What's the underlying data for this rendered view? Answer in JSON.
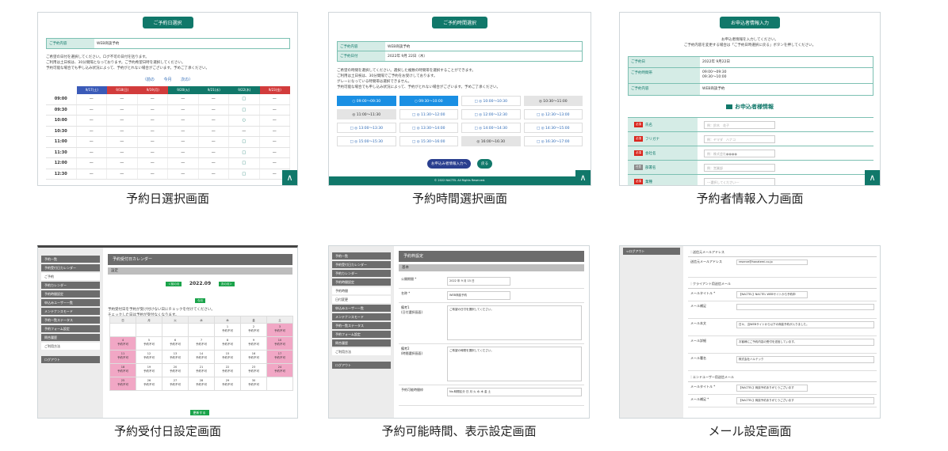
{
  "captions": [
    "予約日選択画面",
    "予約時間選択画面",
    "予約者情報入力画面",
    "予約受付日設定画面",
    "予約可能時間、表示設定画面",
    "メール設定画面"
  ],
  "s1": {
    "pill": "ご予約日選択",
    "row_key": "ご予約内容",
    "row_val": "WEB商談予約",
    "notes": [
      "ご希望の日付を選択してください。ログ不可の日付を括ります。",
      "ご利用は土日祝は、30分間隔となっております。ご予約希望日時を選択してください。",
      "予約可能な場合でも申し込み状況によって、予約がとれない場合がございます。予めご了承ください。"
    ],
    "nav": [
      "〈前の",
      "今月",
      "次の〉"
    ],
    "days": [
      "9/17(土)",
      "9/18(日)",
      "9/19(月)",
      "9/20(火)",
      "9/21(水)",
      "9/22(木)",
      "9/23(金)"
    ],
    "times": [
      "09:00",
      "09:30",
      "10:00",
      "10:30",
      "11:00",
      "11:30",
      "12:00",
      "12:30"
    ]
  },
  "s2": {
    "pill": "ご予約時間選択",
    "rows": [
      {
        "k": "ご予約内容",
        "v": "WEB商談予約"
      },
      {
        "k": "ご予約日付",
        "v": "2022年 9月 22日（木）"
      }
    ],
    "notes": [
      "ご希望の時間を選択してください。選択した複数の時間帯を選択することができます。",
      "ご利用は土日祝は、30分間隔でご予約をお受けしております。",
      "グレーになっている時間帯は選択できません。",
      "予約可能な場合でも申し込み状況によって、予約がとれない場合がございます。予めご了承ください。"
    ],
    "slots": [
      "○ 09:00〜09:30",
      "○ 09:30〜10:00",
      "□ ◎ 10:00〜10:30",
      "◎ 10:30〜11:00",
      "◎ 11:00〜11:30",
      "□ ◎ 11:30〜12:00",
      "□ ◎ 12:00〜12:30",
      "□ ◎ 12:30〜13:00",
      "□ ◎ 13:00〜13:30",
      "□ ◎ 13:30〜14:00",
      "□ ◎ 14:00〜14:30",
      "□ ◎ 14:30〜15:00",
      "□ ◎ 15:00〜15:30",
      "□ ◎ 15:30〜16:00",
      "◎ 16:00〜16:30",
      "□ ◎ 16:30〜17:00"
    ],
    "btn_main": "お申込み者情報入力へ",
    "btn_back": "戻る",
    "footer": "© 2022 NACTEL All Rights Reserved."
  },
  "s3": {
    "pill": "お申込者情報入力",
    "notes": [
      "お申込者情報を入力してください。",
      "ご予約内容を変更する場合は「ご予約日時選択に戻る」ボタンを押してください。"
    ],
    "rows": [
      {
        "k": "ご予約日",
        "v": "2022年 9月22日"
      },
      {
        "k": "ご予約時間帯",
        "v": "09:00〜09:30\n09:30〜10:00"
      },
      {
        "k": "ご予約内容",
        "v": "WEB商談予約"
      }
    ],
    "section": "お申込者様情報",
    "fields": [
      {
        "tag": "必須",
        "label": "氏名",
        "ph": "例：鈴木　花子"
      },
      {
        "tag": "必須",
        "label": "フリガナ",
        "ph": "例：ヤマダ　ハナコ"
      },
      {
        "tag": "必須",
        "label": "会社名",
        "ph": "例：株式会社●●●●"
      },
      {
        "tag": "任意",
        "label": "部署名",
        "ph": "例：営業部"
      },
      {
        "tag": "必須",
        "label": "業種",
        "ph": "---選択してください---"
      }
    ]
  },
  "s4": {
    "menu": [
      "予約一覧",
      "予約受付日カレンダー",
      "ご予約",
      "予約カレンダー",
      "予約時間設定",
      "申込みユーザー一覧",
      "メンテナンスモード",
      "予約一覧ステータス",
      "予約フォーム設定",
      "問合履歴",
      "ご利用方法",
      "ログアウト"
    ],
    "title": "予約受付日カレンダー",
    "sub": "設定",
    "prev": "＜前の月",
    "month": "2022.09",
    "next": "次の月＞",
    "today": "今月",
    "notes": [
      "予約受付日を予約が受け付けない日にチェックを付けてください。",
      "チェックした日は予約が受付なくなります。"
    ],
    "weekdays": [
      "日",
      "月",
      "火",
      "水",
      "木",
      "金",
      "土"
    ],
    "cell_label": "予約不可",
    "days": [
      "",
      "",
      "",
      "",
      "1",
      "2",
      "3",
      "4",
      "5",
      "6",
      "7",
      "8",
      "9",
      "10",
      "11",
      "12",
      "13",
      "14",
      "15",
      "16",
      "17",
      "18",
      "19",
      "20",
      "21",
      "22",
      "23",
      "24",
      "25",
      "26",
      "27",
      "28",
      "29",
      "30",
      ""
    ],
    "pink": [
      6,
      7,
      13,
      14,
      20,
      21,
      27,
      28
    ],
    "save": "更新する"
  },
  "s5": {
    "menu": [
      "予約一覧",
      "予約受付日カレンダー",
      "予約カレンダー",
      "予約時間設定",
      "予約時間",
      "日付変更",
      "申込みユーザー一覧",
      "メンテナンスモード",
      "予約一覧ステータス",
      "予約フォーム設定",
      "問合履歴",
      "ご利用方法",
      "ログアウト"
    ],
    "title": "予約枠設定",
    "sub": "基本",
    "rows": [
      {
        "k": "公開期間 *",
        "v": "2022 年 9 月 15 日"
      },
      {
        "k": "名称 *",
        "v": "WEB商談予約"
      },
      {
        "k": "備考1\n(日付選択画面)",
        "v": "ご希望の日付を選択してください。"
      },
      {
        "k": "備考2\n(時間選択画面)",
        "v": "ご希望の時間を選択してください。"
      },
      {
        "k": "予約可能時間枠",
        "v": "No.時間区分  日 月 火 水 木 金 土"
      }
    ]
  },
  "s6": {
    "logout": "ログアウト",
    "sec1": "送信元メールアドレス",
    "from_label": "送信元メールアドレス",
    "from_val": "reserve@hanatemi.co.jp",
    "sec2": "クライアント用送信メール",
    "rows": [
      {
        "k": "メールタイトル *",
        "v": "【NACTEL】NACTEL WEBサイトから予約申"
      },
      {
        "k": "メール補足",
        "v": ""
      },
      {
        "k": "メール本文",
        "v": "日々、当WEBサイトから以下の商談予約が入りました。"
      },
      {
        "k": "メール詳細",
        "v": "お客様にご予約内容の受付を送信しています。"
      },
      {
        "k": "メール署名",
        "v": "株式会社ハルテック"
      }
    ],
    "sec3": "エンドユーザー用送信メール",
    "rows2": [
      {
        "k": "メールタイトル *",
        "v": "【NACTEL】商談予約ありがとうございます"
      },
      {
        "k": "メール補足 *",
        "v": "【NACTEL】商談予約ありがとうございます"
      }
    ]
  },
  "colors": {
    "teal": "#11786a",
    "blue": "#1a8fe3",
    "pink": "#f1a7c5",
    "grey": "#6c6c6c"
  }
}
